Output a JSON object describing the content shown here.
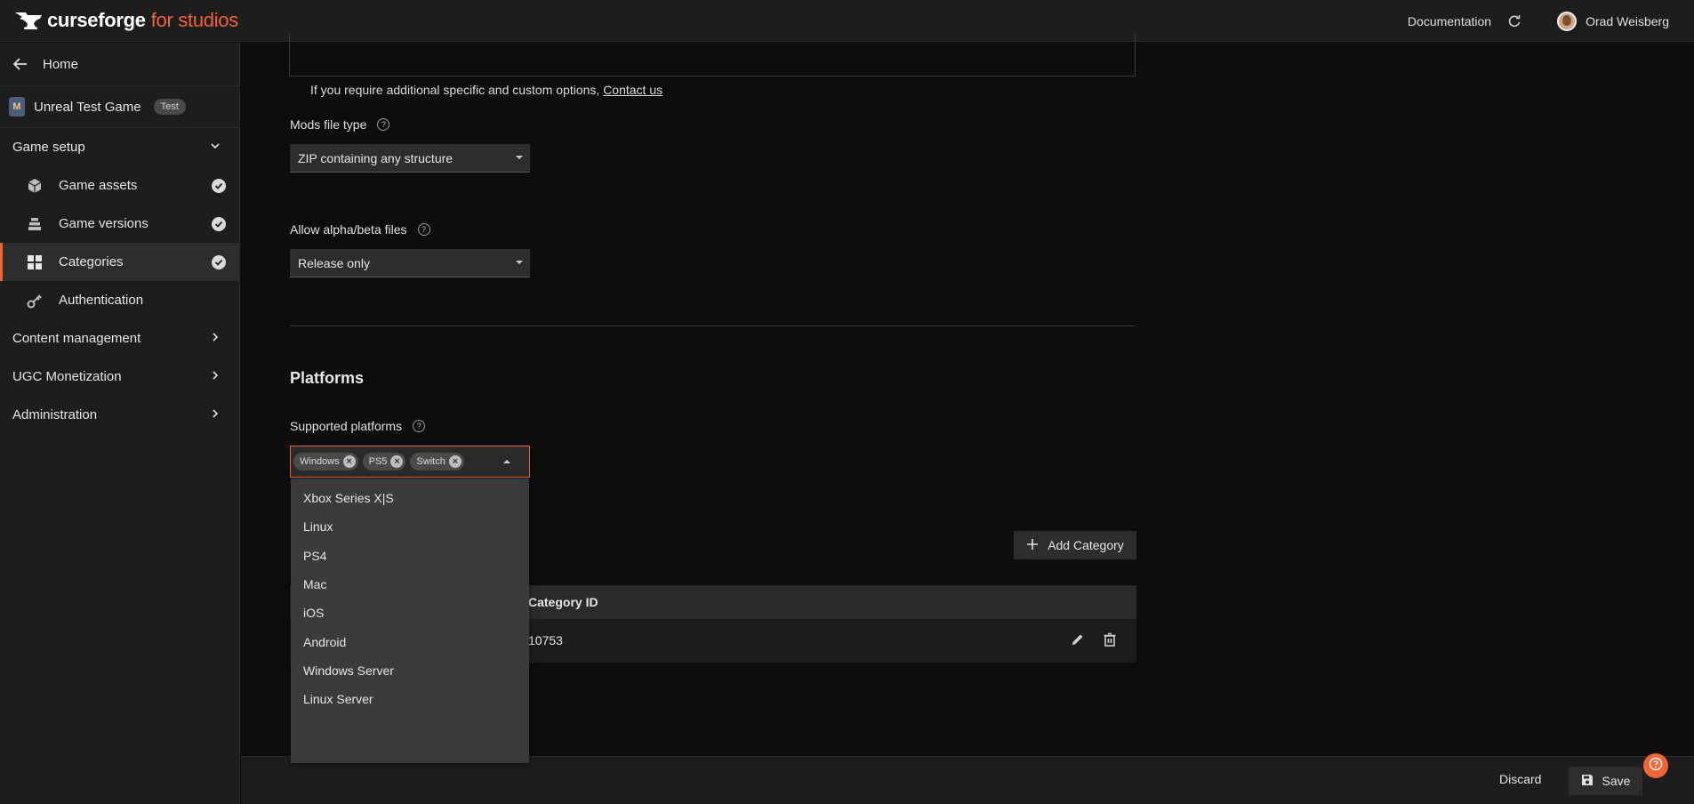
{
  "brand": {
    "name": "curseforge",
    "suffix": "for studios"
  },
  "topnav": {
    "documentation": "Documentation",
    "user_name": "Orad Weisberg"
  },
  "sidebar": {
    "home": "Home",
    "game_name": "Unreal Test Game",
    "game_badge": "Test",
    "sections": [
      {
        "label": "Game setup"
      },
      {
        "label": "Content management"
      },
      {
        "label": "UGC Monetization"
      },
      {
        "label": "Administration"
      }
    ],
    "items": [
      {
        "label": "Game assets"
      },
      {
        "label": "Game versions"
      },
      {
        "label": "Categories"
      },
      {
        "label": "Authentication"
      }
    ]
  },
  "main": {
    "info_text": "If you require additional specific and custom options,",
    "contact_link": "Contact us",
    "mods_file_type_label": "Mods file type",
    "mods_file_type_value": "ZIP containing any structure",
    "allow_alpha_label": "Allow alpha/beta files",
    "allow_alpha_value": "Release only",
    "platforms_title": "Platforms",
    "supported_platforms_label": "Supported platforms",
    "selected_platforms": [
      "Windows",
      "PS5",
      "Switch"
    ],
    "dropdown_options": [
      "Xbox Series X|S",
      "Linux",
      "PS4",
      "Mac",
      "iOS",
      "Android",
      "Windows Server",
      "Linux Server"
    ],
    "add_category_label": "Add Category",
    "table": {
      "header_category_id": "Category ID",
      "row_category_id": "10753"
    }
  },
  "footer": {
    "discard": "Discard",
    "save": "Save"
  },
  "colors": {
    "accent": "#f16436",
    "background": "#0d0d0d",
    "panel": "#1d1d1d"
  }
}
